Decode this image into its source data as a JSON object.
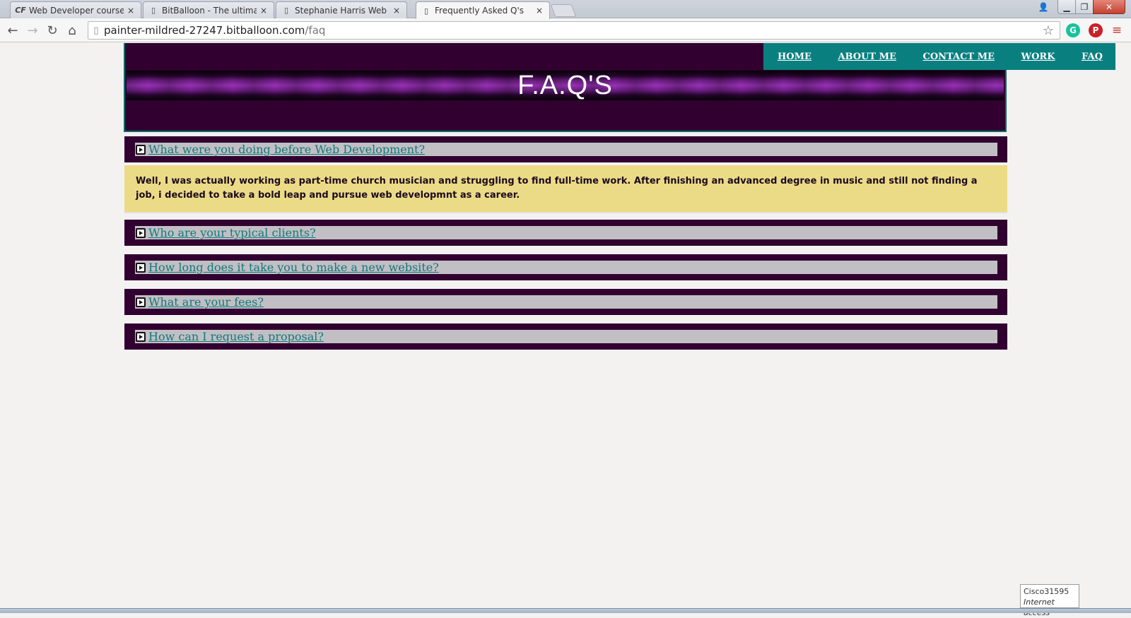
{
  "browser": {
    "tabs": [
      {
        "favicon": "CF",
        "title": "Web Developer course, ex",
        "active": false
      },
      {
        "favicon": "page-icon",
        "title": "BitBalloon - The ultimate",
        "active": false
      },
      {
        "favicon": "page-icon",
        "title": "Stephanie Harris Web",
        "active": false
      },
      {
        "favicon": "page-icon",
        "title": "Frequently Asked Q's",
        "active": true
      }
    ],
    "close_glyph": "×",
    "url_host": "painter-mildred-27247.bitballoon.com",
    "url_path": "/faq"
  },
  "site": {
    "nav": [
      "HOME",
      "ABOUT ME",
      "CONTACT ME",
      "WORK",
      "FAQ"
    ],
    "page_title": "F.A.Q'S",
    "colors": {
      "header_bg": "#310030",
      "nav_bg": "#0a7f80",
      "link": "#0d7b7b",
      "answer_bg": "#ecdb86"
    }
  },
  "faqs": [
    {
      "question": "What were you doing before Web Development?",
      "expanded": true,
      "answer": "Well, I was actually working as part-time church musician and struggling to find full-time work. After finishing an advanced degree in music and still not finding a job, i decided to take a bold leap and pursue web developmnt as a career."
    },
    {
      "question": "Who are your typical clients?",
      "expanded": false
    },
    {
      "question": "How long does it take you to make a new website?",
      "expanded": false
    },
    {
      "question": "What are your fees?",
      "expanded": false
    },
    {
      "question": "How can I request a proposal?",
      "expanded": false
    }
  ],
  "system": {
    "tooltip_title": "Cisco31595",
    "tooltip_status": "Internet access"
  }
}
